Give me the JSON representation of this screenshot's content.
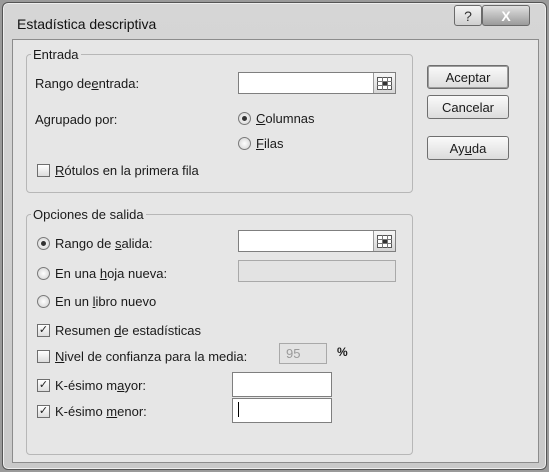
{
  "window": {
    "title": "Estadística descriptiva",
    "help_label": "?",
    "close_label": "X"
  },
  "entrada": {
    "legend": "Entrada",
    "rango_label_pre": "Rango de ",
    "rango_label_ul": "e",
    "rango_label_post": "ntrada:",
    "agrupado_label": "Agrupado por:",
    "columnas_ul": "C",
    "columnas_post": "olumnas",
    "filas_ul": "F",
    "filas_post": "ilas",
    "rotulos_ul": "R",
    "rotulos_post": "ótulos en la primera fila",
    "agrupado_selected": "Columnas"
  },
  "salida": {
    "legend": "Opciones de salida",
    "rango_pre": "Rango de ",
    "rango_ul": "s",
    "rango_post": "alida:",
    "hoja_pre": "En una ",
    "hoja_ul": "h",
    "hoja_post": "oja nueva:",
    "libro_pre": "En un ",
    "libro_ul": "l",
    "libro_post": "ibro nuevo",
    "resumen_pre": "Resumen ",
    "resumen_ul": "d",
    "resumen_post": "e estadísticas",
    "nivel_ul": "N",
    "nivel_post": "ivel de confianza para la media:",
    "nivel_value": "95",
    "percent": "%",
    "kmayor_pre": "K-ésimo m",
    "kmayor_ul": "a",
    "kmayor_post": "yor:",
    "kmenor_pre": "K-ésimo ",
    "kmenor_ul": "m",
    "kmenor_post": "enor:",
    "check_mark": "✓"
  },
  "buttons": {
    "aceptar": "Aceptar",
    "cancelar": "Cancelar",
    "ayuda_pre": "Ay",
    "ayuda_ul": "u",
    "ayuda_post": "da"
  },
  "icons": {
    "range": "range-select-icon"
  }
}
